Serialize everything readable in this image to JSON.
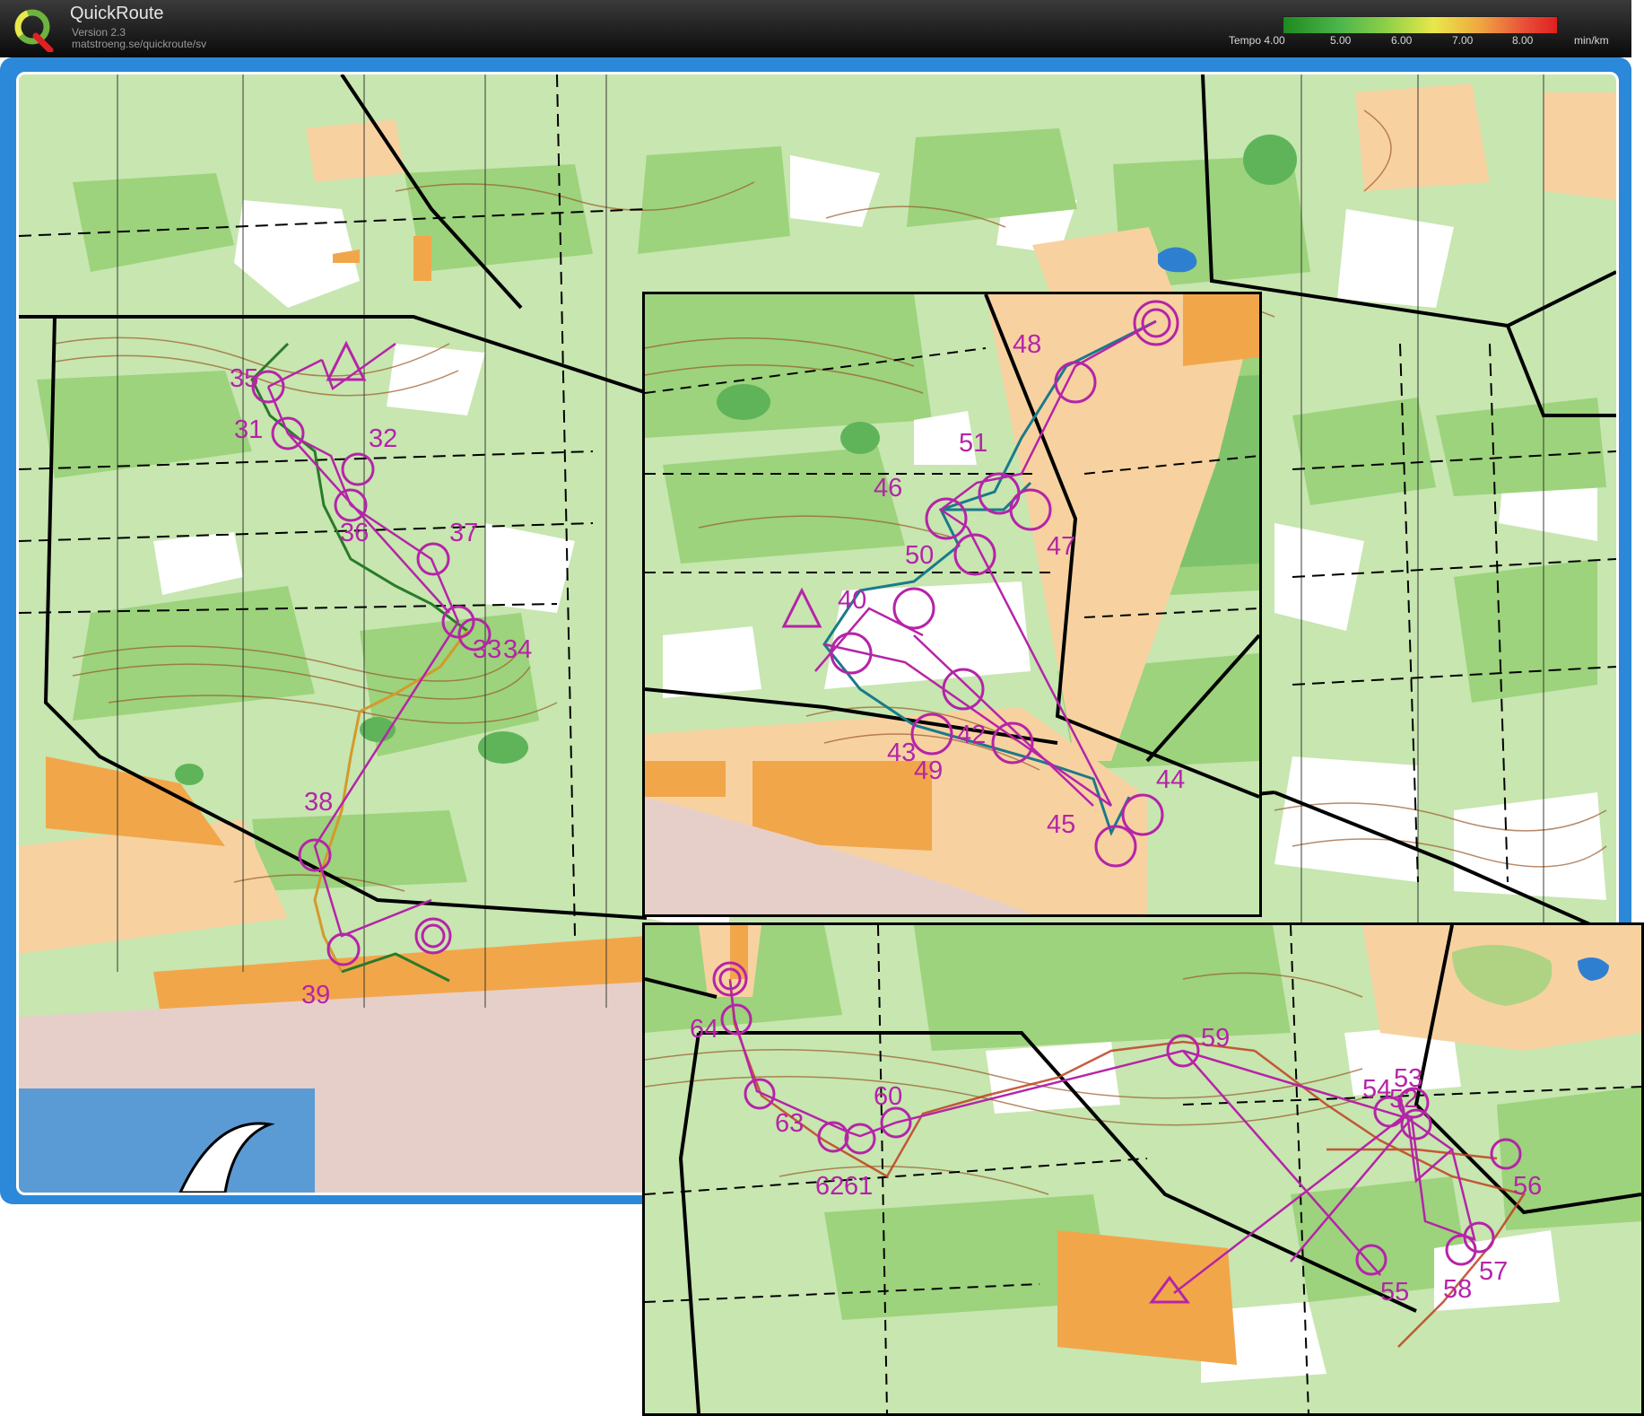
{
  "header": {
    "app_name": "QuickRoute",
    "version": "Version 2.3",
    "url": "matstroeng.se/quickroute/sv",
    "logo_letter": "Q",
    "tempo_label": "Tempo",
    "tempo_ticks": [
      "4.00",
      "5.00",
      "6.00",
      "7.00",
      "8.00"
    ],
    "tempo_unit": "min/km",
    "tempo_colors": [
      "#1e8a1e",
      "#49b54a",
      "#8fd048",
      "#e8e84a",
      "#f0a640",
      "#e8503a",
      "#e02020"
    ]
  },
  "map": {
    "colors": {
      "forest_light": "#c7e6b0",
      "forest_mid": "#9cd37c",
      "forest_dark": "#5fb45a",
      "open": "#f7d2a0",
      "open_orange": "#f2a64a",
      "water": "#5b9bd5",
      "sea": "#e6cfc8",
      "course": "#b524a8",
      "contour": "#9a5a2a"
    },
    "main_controls": [
      "35",
      "31",
      "32",
      "36",
      "37",
      "33",
      "34",
      "38",
      "39"
    ],
    "inset1_controls": [
      "48",
      "51",
      "46",
      "47",
      "50",
      "40",
      "42",
      "43",
      "49",
      "44",
      "45"
    ],
    "inset2_controls": [
      "64",
      "59",
      "60",
      "63",
      "62",
      "61",
      "54",
      "53",
      "52",
      "56",
      "55",
      "57",
      "58"
    ]
  }
}
